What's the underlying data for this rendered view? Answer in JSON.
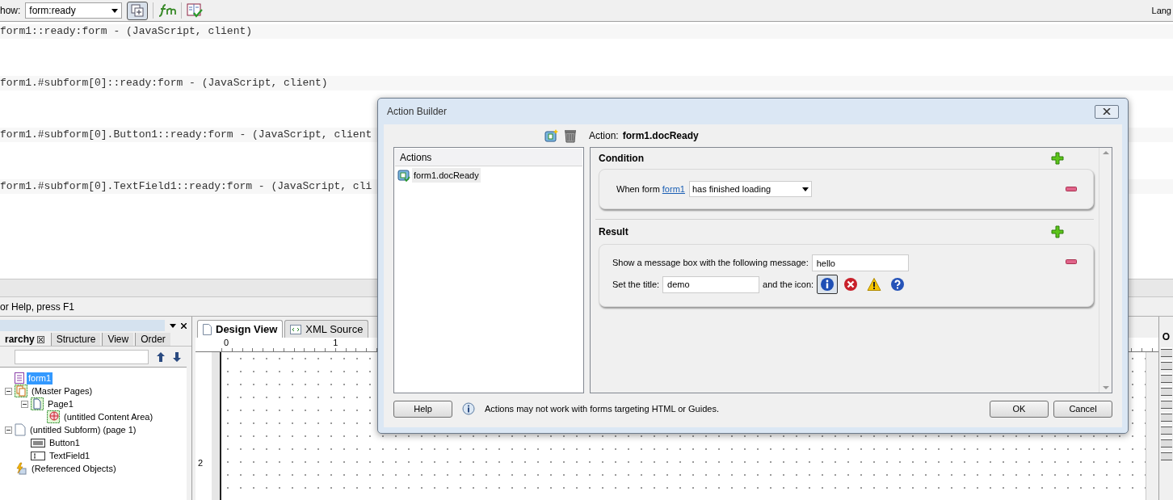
{
  "toolbar": {
    "show_label": "how:",
    "event_select": "form:ready",
    "lang_label": "Lang"
  },
  "script_lines": [
    "form1::ready:form - (JavaScript, client)",
    "form1.#subform[0]::ready:form - (JavaScript, client)",
    "form1.#subform[0].Button1::ready:form - (JavaScript, client",
    "form1.#subform[0].TextField1::ready:form - (JavaScript, cli"
  ],
  "status_bar": "or Help, press F1",
  "hierarchy_panel": {
    "tabs": [
      {
        "label": "rarchy",
        "selected": true
      },
      {
        "label": "Structure",
        "selected": false
      },
      {
        "label": "View",
        "selected": false
      },
      {
        "label": "Order",
        "selected": false
      }
    ],
    "tree": [
      {
        "label": "form1",
        "kind": "form",
        "selected": true
      },
      {
        "label": "(Master Pages)",
        "kind": "master",
        "selected": false,
        "expanded": true,
        "children": [
          {
            "label": "Page1",
            "kind": "page",
            "selected": false,
            "expanded": true,
            "children": [
              {
                "label": "(untitled Content Area)",
                "kind": "content",
                "selected": false
              }
            ]
          }
        ]
      },
      {
        "label": "(untitled Subform) (page 1)",
        "kind": "subform",
        "selected": false,
        "expanded": true,
        "children": [
          {
            "label": "Button1",
            "kind": "button",
            "selected": false
          },
          {
            "label": "TextField1",
            "kind": "textfield",
            "selected": false
          }
        ]
      },
      {
        "label": "(Referenced Objects)",
        "kind": "referenced",
        "selected": false
      }
    ]
  },
  "design_tabs": [
    {
      "label": "Design View",
      "selected": true
    },
    {
      "label": "XML Source",
      "selected": false
    }
  ],
  "ruler": {
    "h_labels": [
      "0",
      "1"
    ],
    "v_labels": [
      "2"
    ]
  },
  "right_panel_tab": "O",
  "dialog": {
    "title": "Action Builder",
    "action_label": "Action:",
    "action_name": "form1.docReady",
    "actions_header": "Actions",
    "actions": [
      {
        "label": "form1.docReady",
        "selected": true
      }
    ],
    "condition": {
      "heading": "Condition",
      "prefix": "When form",
      "link": "form1",
      "select": "has finished loading"
    },
    "result": {
      "heading": "Result",
      "message_label": "Show a message box with the following message:",
      "message_value": "hello",
      "title_label": "Set the title:",
      "title_value": "demo",
      "icon_label": "and the icon:",
      "icons": [
        {
          "kind": "info",
          "selected": true
        },
        {
          "kind": "error",
          "selected": false
        },
        {
          "kind": "warning",
          "selected": false
        },
        {
          "kind": "question",
          "selected": false
        }
      ]
    },
    "note": "Actions may not work with forms targeting HTML or Guides.",
    "help": "Help",
    "ok": "OK",
    "cancel": "Cancel"
  }
}
